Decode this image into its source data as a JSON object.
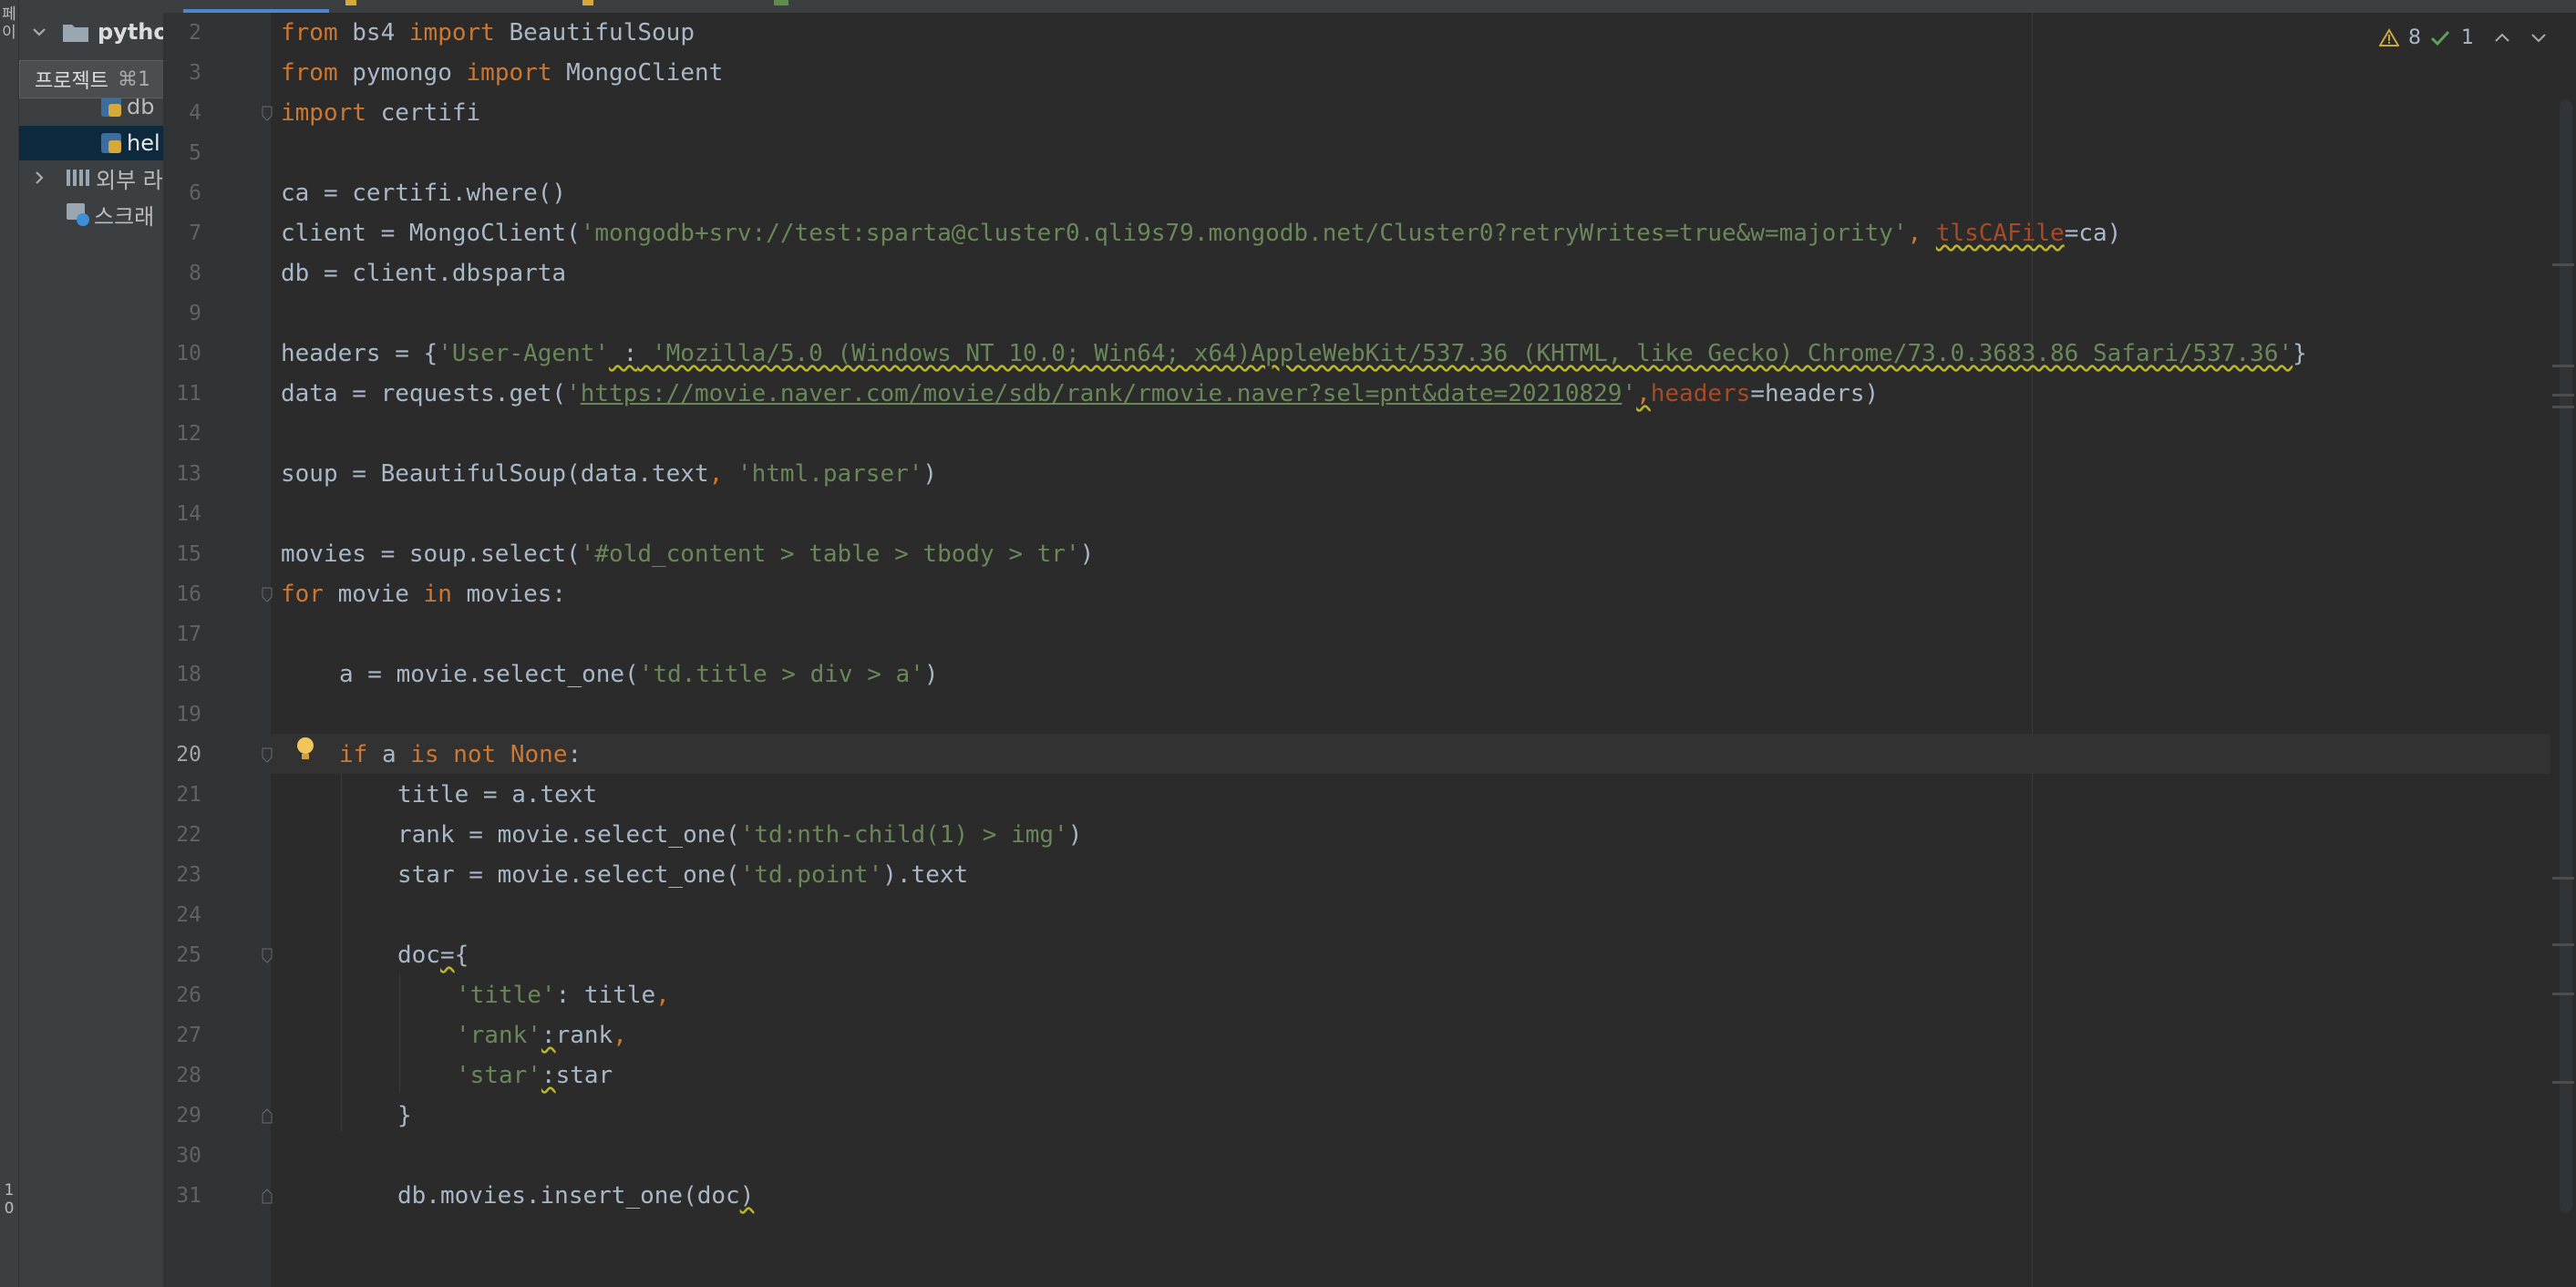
{
  "project_panel": {
    "root_label": "pytho",
    "tooltip_label": "프로젝트",
    "tooltip_shortcut": "⌘1",
    "items": [
      {
        "label": "db"
      },
      {
        "label": "hel"
      },
      {
        "label": "외부 라"
      },
      {
        "label": "스크래"
      }
    ]
  },
  "left_strip": {
    "top_text": "페\n이",
    "bottom_text": "1\n0"
  },
  "inspection": {
    "warnings": "8",
    "weak_warnings": "1",
    "warning_icon": "warning-triangle-icon",
    "check_icon": "check-icon"
  },
  "editor": {
    "current_line": "20",
    "lines": [
      {
        "n": "2"
      },
      {
        "n": "3"
      },
      {
        "n": "4"
      },
      {
        "n": "5"
      },
      {
        "n": "6"
      },
      {
        "n": "7"
      },
      {
        "n": "8"
      },
      {
        "n": "9"
      },
      {
        "n": "10"
      },
      {
        "n": "11"
      },
      {
        "n": "12"
      },
      {
        "n": "13"
      },
      {
        "n": "14"
      },
      {
        "n": "15"
      },
      {
        "n": "16"
      },
      {
        "n": "17"
      },
      {
        "n": "18"
      },
      {
        "n": "19"
      },
      {
        "n": "20"
      },
      {
        "n": "21"
      },
      {
        "n": "22"
      },
      {
        "n": "23"
      },
      {
        "n": "24"
      },
      {
        "n": "25"
      },
      {
        "n": "26"
      },
      {
        "n": "27"
      },
      {
        "n": "28"
      },
      {
        "n": "29"
      },
      {
        "n": "30"
      },
      {
        "n": "31"
      }
    ],
    "code": {
      "l2": {
        "a": "from",
        "b": " bs4 ",
        "c": "import",
        "d": " BeautifulSoup"
      },
      "l3": {
        "a": "from",
        "b": " pymongo ",
        "c": "import",
        "d": " MongoClient"
      },
      "l4": {
        "a": "import",
        "b": " certifi"
      },
      "l6": {
        "a": "ca = certifi.where()"
      },
      "l7": {
        "a": "client = MongoClient(",
        "b": "'mongodb+srv://test:sparta@cluster0.qli9s79.mongodb.net/Cluster0?retryWrites=true&w=majority'",
        "c": ", ",
        "d": "tlsCAFile",
        "e": "=ca)"
      },
      "l8": {
        "a": "db = client.dbsparta"
      },
      "l10": {
        "a": "headers = {",
        "b": "'User-Agent'",
        "c": " :",
        "d": " 'Mozilla/5.0 (Windows NT 10.0; Win64; x64)AppleWebKit/537.36 (KHTML, like Gecko) Chrome/73.0.3683.86 Safari/537.36'",
        "e": "}"
      },
      "l11": {
        "a": "data = requests.get(",
        "b": "'",
        "c": "https://movie.naver.com/movie/sdb/rank/rmovie.naver?sel=pnt&date=20210829",
        "d": "'",
        "e": ",",
        "f": "headers",
        "g": "=headers)"
      },
      "l13": {
        "a": "soup = BeautifulSoup(data.text",
        "b": ", ",
        "c": "'html.parser'",
        "d": ")"
      },
      "l15": {
        "a": "movies = soup.select(",
        "b": "'#old_content > table > tbody > tr'",
        "c": ")"
      },
      "l16": {
        "a": "for",
        "b": " movie ",
        "c": "in",
        "d": " movies:"
      },
      "l18": {
        "a": "a = movie.select_one(",
        "b": "'td.title > div > a'",
        "c": ")"
      },
      "l20": {
        "a": "if",
        "b": " a ",
        "c": "is not None",
        "d": ":"
      },
      "l21": {
        "a": "title = a.text"
      },
      "l22": {
        "a": "rank = movie.select_one(",
        "b": "'td:nth-child(1) > img'",
        "c": ")"
      },
      "l23": {
        "a": "star = movie.select_one(",
        "b": "'td.point'",
        "c": ").text"
      },
      "l25": {
        "a": "doc",
        "b": "=",
        "c": "{"
      },
      "l26": {
        "a": "'title'",
        "b": ": title",
        "c": ","
      },
      "l27": {
        "a": "'rank'",
        "b": ":",
        "c": "rank",
        "d": ","
      },
      "l28": {
        "a": "'star'",
        "b": ":",
        "c": "star"
      },
      "l29": {
        "a": "}"
      },
      "l31": {
        "a": "db.movies.insert_one(doc",
        "b": ")"
      }
    }
  },
  "colors": {
    "keyword": "#cc7832",
    "string": "#6a8759",
    "param": "#aa4926",
    "text": "#a9b7c6",
    "bg": "#2b2b2b"
  }
}
